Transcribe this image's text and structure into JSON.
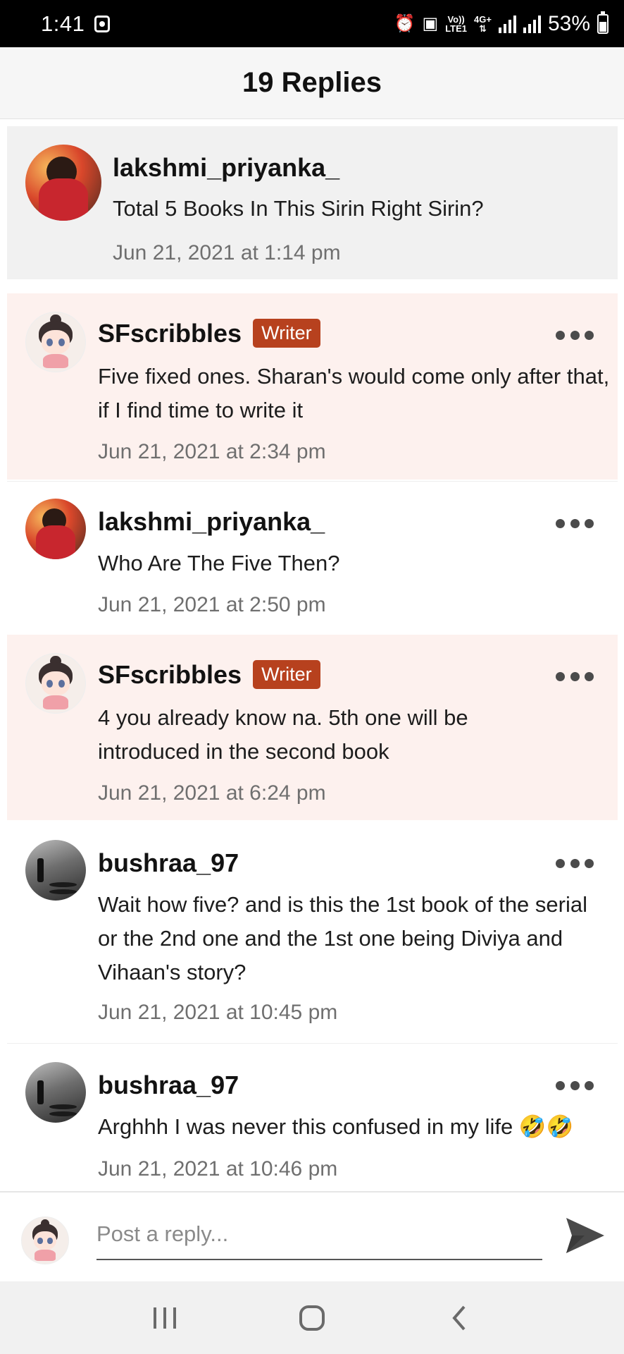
{
  "status_bar": {
    "time": "1:41",
    "network_top": "Vo))",
    "network_bottom": "LTE1",
    "network_type": "4G+",
    "battery": "53%"
  },
  "header": {
    "title": "19 Replies"
  },
  "comments": [
    {
      "username": "lakshmi_priyanka_",
      "text": "Total 5 Books In This Sirin Right Sirin?",
      "time": "Jun 21, 2021 at 1:14 pm",
      "avatar_icon": "couple-avatar",
      "background": "#f1f1f1"
    },
    {
      "username": "SFscribbles",
      "badge": "Writer",
      "text": "Five fixed ones. Sharan's would come only after that, if I find time to write it",
      "time": "Jun 21, 2021 at 2:34 pm",
      "avatar_icon": "chibi-avatar",
      "background": "#fdf1ee"
    },
    {
      "username": "lakshmi_priyanka_",
      "text": "Who Are The Five Then?",
      "time": "Jun 21, 2021 at 2:50 pm",
      "avatar_icon": "couple-avatar",
      "background": "#ffffff"
    },
    {
      "username": "SFscribbles",
      "badge": "Writer",
      "text": "4 you already know na. 5th one will be introduced in the second book",
      "time": "Jun 21, 2021 at 6:24 pm",
      "avatar_icon": "chibi-avatar",
      "background": "#fdf1ee"
    },
    {
      "username": "bushraa_97",
      "text": "Wait how five? and is this the 1st book of the serial or the 2nd one and the 1st one being Diviya and Vihaan's story?",
      "time": "Jun 21, 2021 at 10:45 pm",
      "avatar_icon": "street-avatar",
      "background": "#ffffff"
    },
    {
      "username": "bushraa_97",
      "text": "Arghhh I was never this confused in my life 🤣🤣",
      "time": "Jun 21, 2021 at 10:46 pm",
      "avatar_icon": "street-avatar",
      "background": "#ffffff"
    }
  ],
  "composer": {
    "placeholder": "Post a reply..."
  },
  "colors": {
    "writer_badge": "#b7411e",
    "writer_bg": "#fdf1ee",
    "parent_bg": "#f1f1f1"
  }
}
